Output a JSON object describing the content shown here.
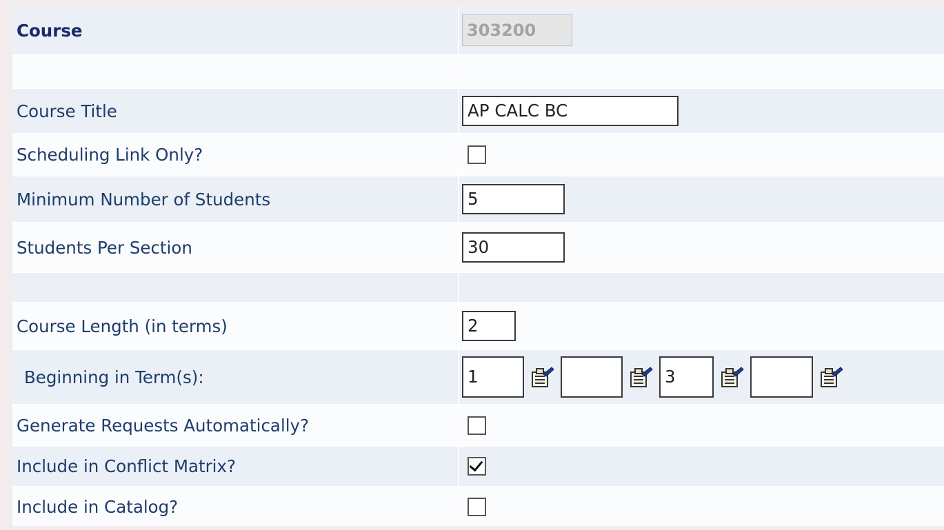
{
  "fields": {
    "course": {
      "label": "Course",
      "value": "303200"
    },
    "course_title": {
      "label": "Course Title",
      "value": "AP CALC BC"
    },
    "scheduling_link_only": {
      "label": "Scheduling Link Only?",
      "checked": false
    },
    "min_students": {
      "label": "Minimum Number of Students",
      "value": "5"
    },
    "students_per_section": {
      "label": "Students Per Section",
      "value": "30"
    },
    "course_length": {
      "label": "Course Length (in terms)",
      "value": "2"
    },
    "beginning_terms": {
      "label": "Beginning in Term(s):",
      "terms": [
        "1",
        "",
        "3",
        ""
      ],
      "picker_icon": "term-picker-icon"
    },
    "generate_requests": {
      "label": "Generate Requests Automatically?",
      "checked": false
    },
    "conflict_matrix": {
      "label": "Include in Conflict Matrix?",
      "checked": true
    },
    "include_catalog": {
      "label": "Include in Catalog?",
      "checked": false
    }
  },
  "colors": {
    "label_text": "#1e3d6b",
    "row_shaded": "#eaf0f6",
    "row_plain": "#fbfcfd",
    "page_bg": "#f3ecef"
  }
}
